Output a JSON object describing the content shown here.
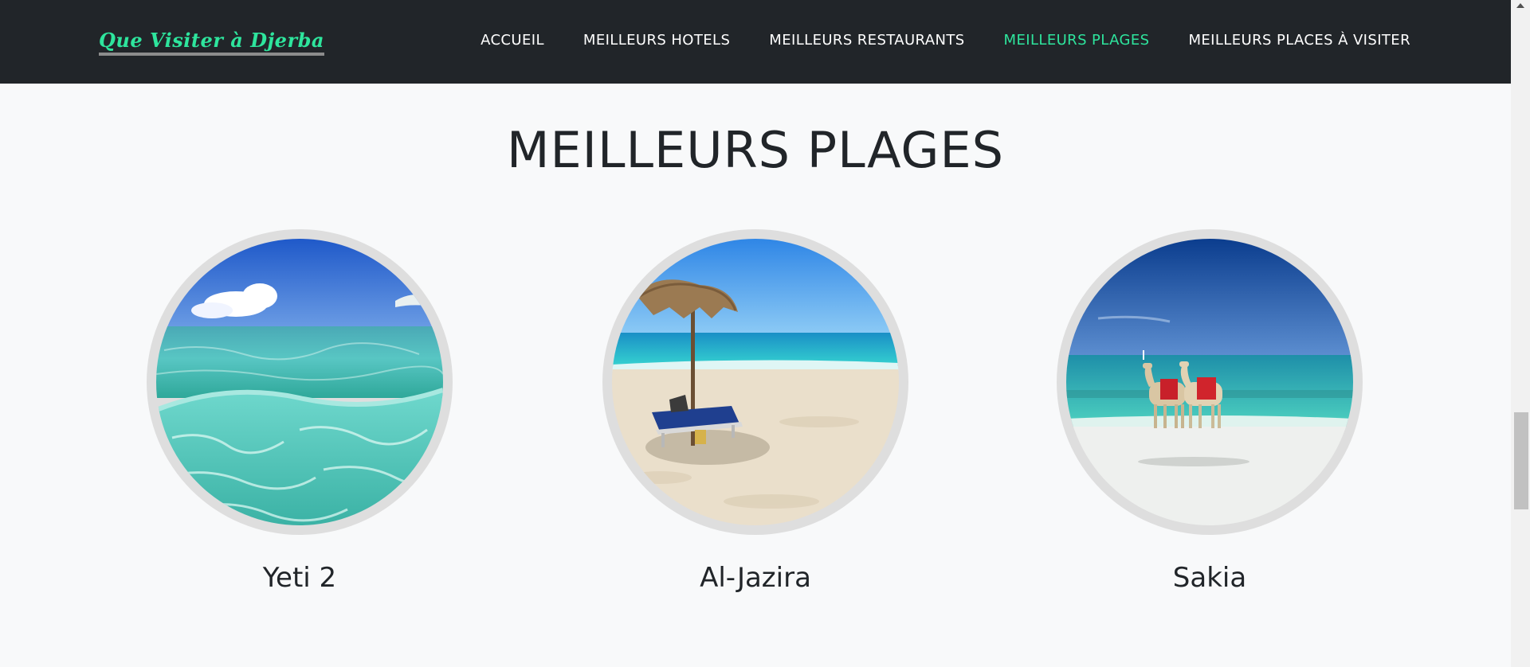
{
  "brand": "Que Visiter à Djerba",
  "nav": {
    "items": [
      {
        "label": "ACCUEIL",
        "active": false
      },
      {
        "label": "MEILLEURS HOTELS",
        "active": false
      },
      {
        "label": "MEILLEURS RESTAURANTS",
        "active": false
      },
      {
        "label": "MEILLEURS PLAGES",
        "active": true
      },
      {
        "label": "MEILLEURS PLACES À VISITER",
        "active": false
      }
    ]
  },
  "section": {
    "title": "MEILLEURS PLAGES",
    "beaches": [
      {
        "name": "Yeti 2",
        "image": "underwater-turquoise-sea-photo"
      },
      {
        "name": "Al-Jazira",
        "image": "beach-umbrella-loungers-photo"
      },
      {
        "name": "Sakia",
        "image": "camels-on-beach-photo"
      }
    ]
  },
  "colors": {
    "navbar": "#212529",
    "accent": "#2ee59d",
    "background": "#f8f9fa",
    "text": "#212529"
  }
}
